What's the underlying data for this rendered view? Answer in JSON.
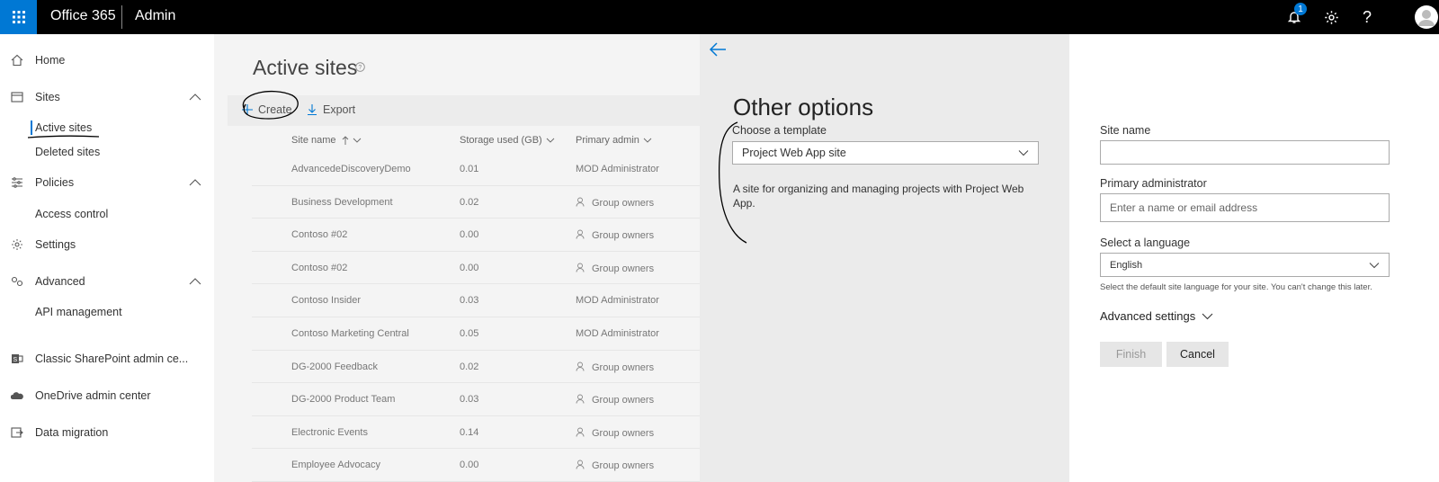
{
  "topbar": {
    "app_name": "Office 365",
    "section": "Admin",
    "notification_count": "1",
    "help_symbol": "?"
  },
  "leftnav": {
    "home": "Home",
    "sites": "Sites",
    "active_sites": "Active sites",
    "deleted_sites": "Deleted sites",
    "policies": "Policies",
    "access_control": "Access control",
    "settings": "Settings",
    "advanced": "Advanced",
    "api_management": "API management",
    "classic": "Classic SharePoint admin ce...",
    "onedrive": "OneDrive admin center",
    "data_migration": "Data migration"
  },
  "main": {
    "title": "Active sites",
    "create": "Create",
    "export": "Export",
    "columns": {
      "site_name": "Site name",
      "storage": "Storage used (GB)",
      "admin": "Primary admin"
    },
    "rows": [
      {
        "name": "AdvancedeDiscoveryDemo",
        "storage": "0.01",
        "admin": "MOD Administrator",
        "group": false
      },
      {
        "name": "Business Development",
        "storage": "0.02",
        "admin": "Group owners",
        "group": true
      },
      {
        "name": "Contoso #02",
        "storage": "0.00",
        "admin": "Group owners",
        "group": true
      },
      {
        "name": "Contoso #02",
        "storage": "0.00",
        "admin": "Group owners",
        "group": true
      },
      {
        "name": "Contoso Insider",
        "storage": "0.03",
        "admin": "MOD Administrator",
        "group": false
      },
      {
        "name": "Contoso Marketing Central",
        "storage": "0.05",
        "admin": "MOD Administrator",
        "group": false
      },
      {
        "name": "DG-2000 Feedback",
        "storage": "0.02",
        "admin": "Group owners",
        "group": true
      },
      {
        "name": "DG-2000 Product Team",
        "storage": "0.03",
        "admin": "Group owners",
        "group": true
      },
      {
        "name": "Electronic Events",
        "storage": "0.14",
        "admin": "Group owners",
        "group": true
      },
      {
        "name": "Employee Advocacy",
        "storage": "0.00",
        "admin": "Group owners",
        "group": true
      }
    ]
  },
  "panel": {
    "title": "Other options",
    "template_label": "Choose a template",
    "template_value": "Project Web App site",
    "template_desc": "A site for organizing and managing projects with Project Web App.",
    "site_name_label": "Site name",
    "site_name_value": "",
    "primary_admin_label": "Primary administrator",
    "primary_admin_placeholder": "Enter a name or email address",
    "language_label": "Select a language",
    "language_value": "English",
    "language_hint": "Select the default site language for your site. You can't change this later.",
    "advanced_settings": "Advanced settings",
    "finish": "Finish",
    "cancel": "Cancel"
  },
  "colors": {
    "accent": "#0078d4",
    "topbar": "#000000",
    "panel_left_bg": "#ebebeb"
  }
}
